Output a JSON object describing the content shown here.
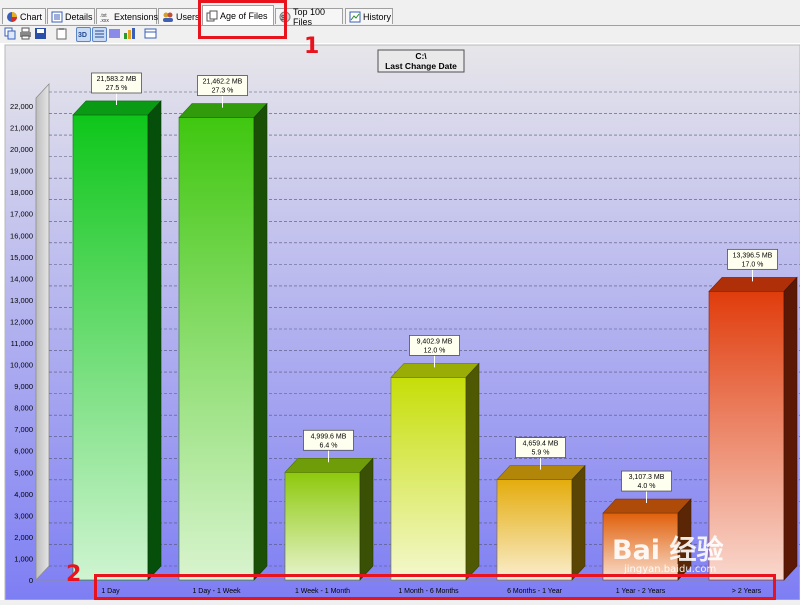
{
  "tabs": [
    {
      "label": "Chart",
      "icon": "pie-chart-icon",
      "active": false
    },
    {
      "label": "Details",
      "icon": "details-list-icon",
      "active": false
    },
    {
      "label": "Extensions",
      "icon": "extensions-icon",
      "active": false
    },
    {
      "label": "Users",
      "icon": "users-icon",
      "active": false
    },
    {
      "label": "Age of Files",
      "icon": "age-of-files-icon",
      "active": true
    },
    {
      "label": "Top 100 Files",
      "icon": "top-files-icon",
      "active": false
    },
    {
      "label": "History",
      "icon": "history-icon",
      "active": false
    }
  ],
  "toolbar": {
    "buttons": [
      "copy-icon",
      "print-icon",
      "save-icon",
      "clipboard-icon",
      "3d-view-icon",
      "grid-view-icon",
      "color-view-icon",
      "bar-chart-icon",
      "table-view-icon"
    ]
  },
  "annotations": {
    "number_1": "1",
    "number_2": "2"
  },
  "watermark": {
    "logo": "Bai 经验",
    "url": "jingyan.baidu.com"
  },
  "colors": {
    "accent_annotation": "#e8131c",
    "plot_top": "#e7e6ea",
    "plot_bottom": "#7e7ef4"
  },
  "chart_data": {
    "type": "bar",
    "title": "C:\\",
    "subtitle": "Last Change Date",
    "categories": [
      "1 Day",
      "1 Day - 1 Week",
      "1 Week - 1 Month",
      "1 Month - 6 Months",
      "6 Months - 1 Year",
      "1 Year - 2 Years",
      "> 2 Years"
    ],
    "values": [
      21583.2,
      21462.2,
      4999.6,
      9402.9,
      4659.4,
      3107.3,
      13396.5
    ],
    "value_labels": [
      "21,583.2 MB",
      "21,462.2 MB",
      "4,999.6 MB",
      "9,402.9 MB",
      "4,659.4 MB",
      "3,107.3 MB",
      "13,396.5 MB"
    ],
    "percent_labels": [
      "27.5 %",
      "27.3 %",
      "6.4 %",
      "12.0 %",
      "5.9 %",
      "4.0 %",
      "17.0 %"
    ],
    "bar_colors": [
      "#0ec61a",
      "#40c710",
      "#8ec90c",
      "#c6de08",
      "#e4ac0c",
      "#e0600c",
      "#e03c0c"
    ],
    "yticks": [
      "0",
      "1,000",
      "2,000",
      "3,000",
      "4,000",
      "5,000",
      "6,000",
      "7,000",
      "8,000",
      "9,000",
      "10,000",
      "11,000",
      "12,000",
      "13,000",
      "14,000",
      "15,000",
      "16,000",
      "17,000",
      "18,000",
      "19,000",
      "20,000",
      "21,000",
      "22,000"
    ],
    "ylim": [
      0,
      22000
    ],
    "grid": true
  }
}
